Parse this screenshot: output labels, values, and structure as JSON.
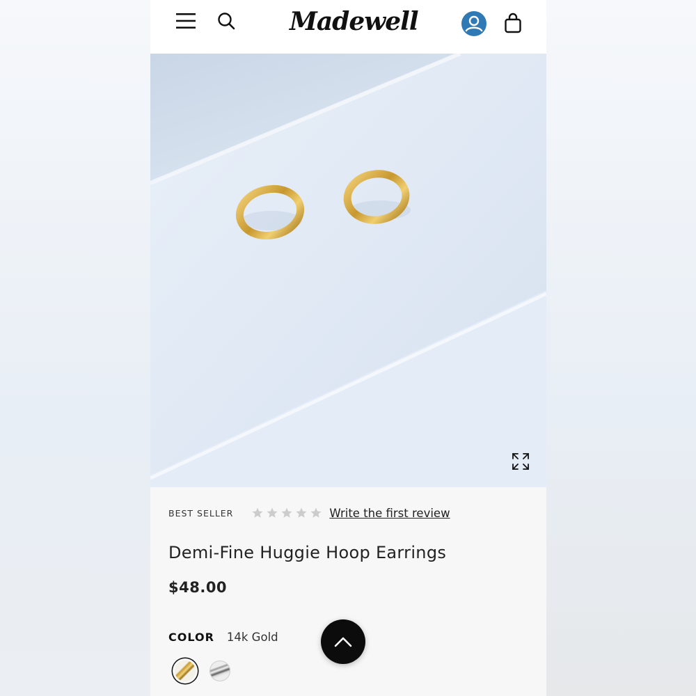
{
  "header": {
    "brand": "Madewell",
    "icons": [
      "menu-icon",
      "search-icon",
      "account-icon",
      "bag-icon"
    ]
  },
  "hero": {
    "icons": [
      "expand-icon"
    ]
  },
  "product": {
    "badge": "BEST SELLER",
    "rating": {
      "value": 0,
      "max": 5
    },
    "review_link": "Write the first review",
    "name": "Demi-Fine Huggie Hoop Earrings",
    "price": "$48.00",
    "color_label": "COLOR",
    "color_value": "14k Gold",
    "swatches": [
      {
        "name": "14k Gold",
        "selected": true
      },
      {
        "name": "Silver",
        "selected": false
      }
    ]
  },
  "colors": {
    "accent_blue": "#2f79b5",
    "star_empty": "#cccccc",
    "button_dark": "#0c0c0c"
  }
}
